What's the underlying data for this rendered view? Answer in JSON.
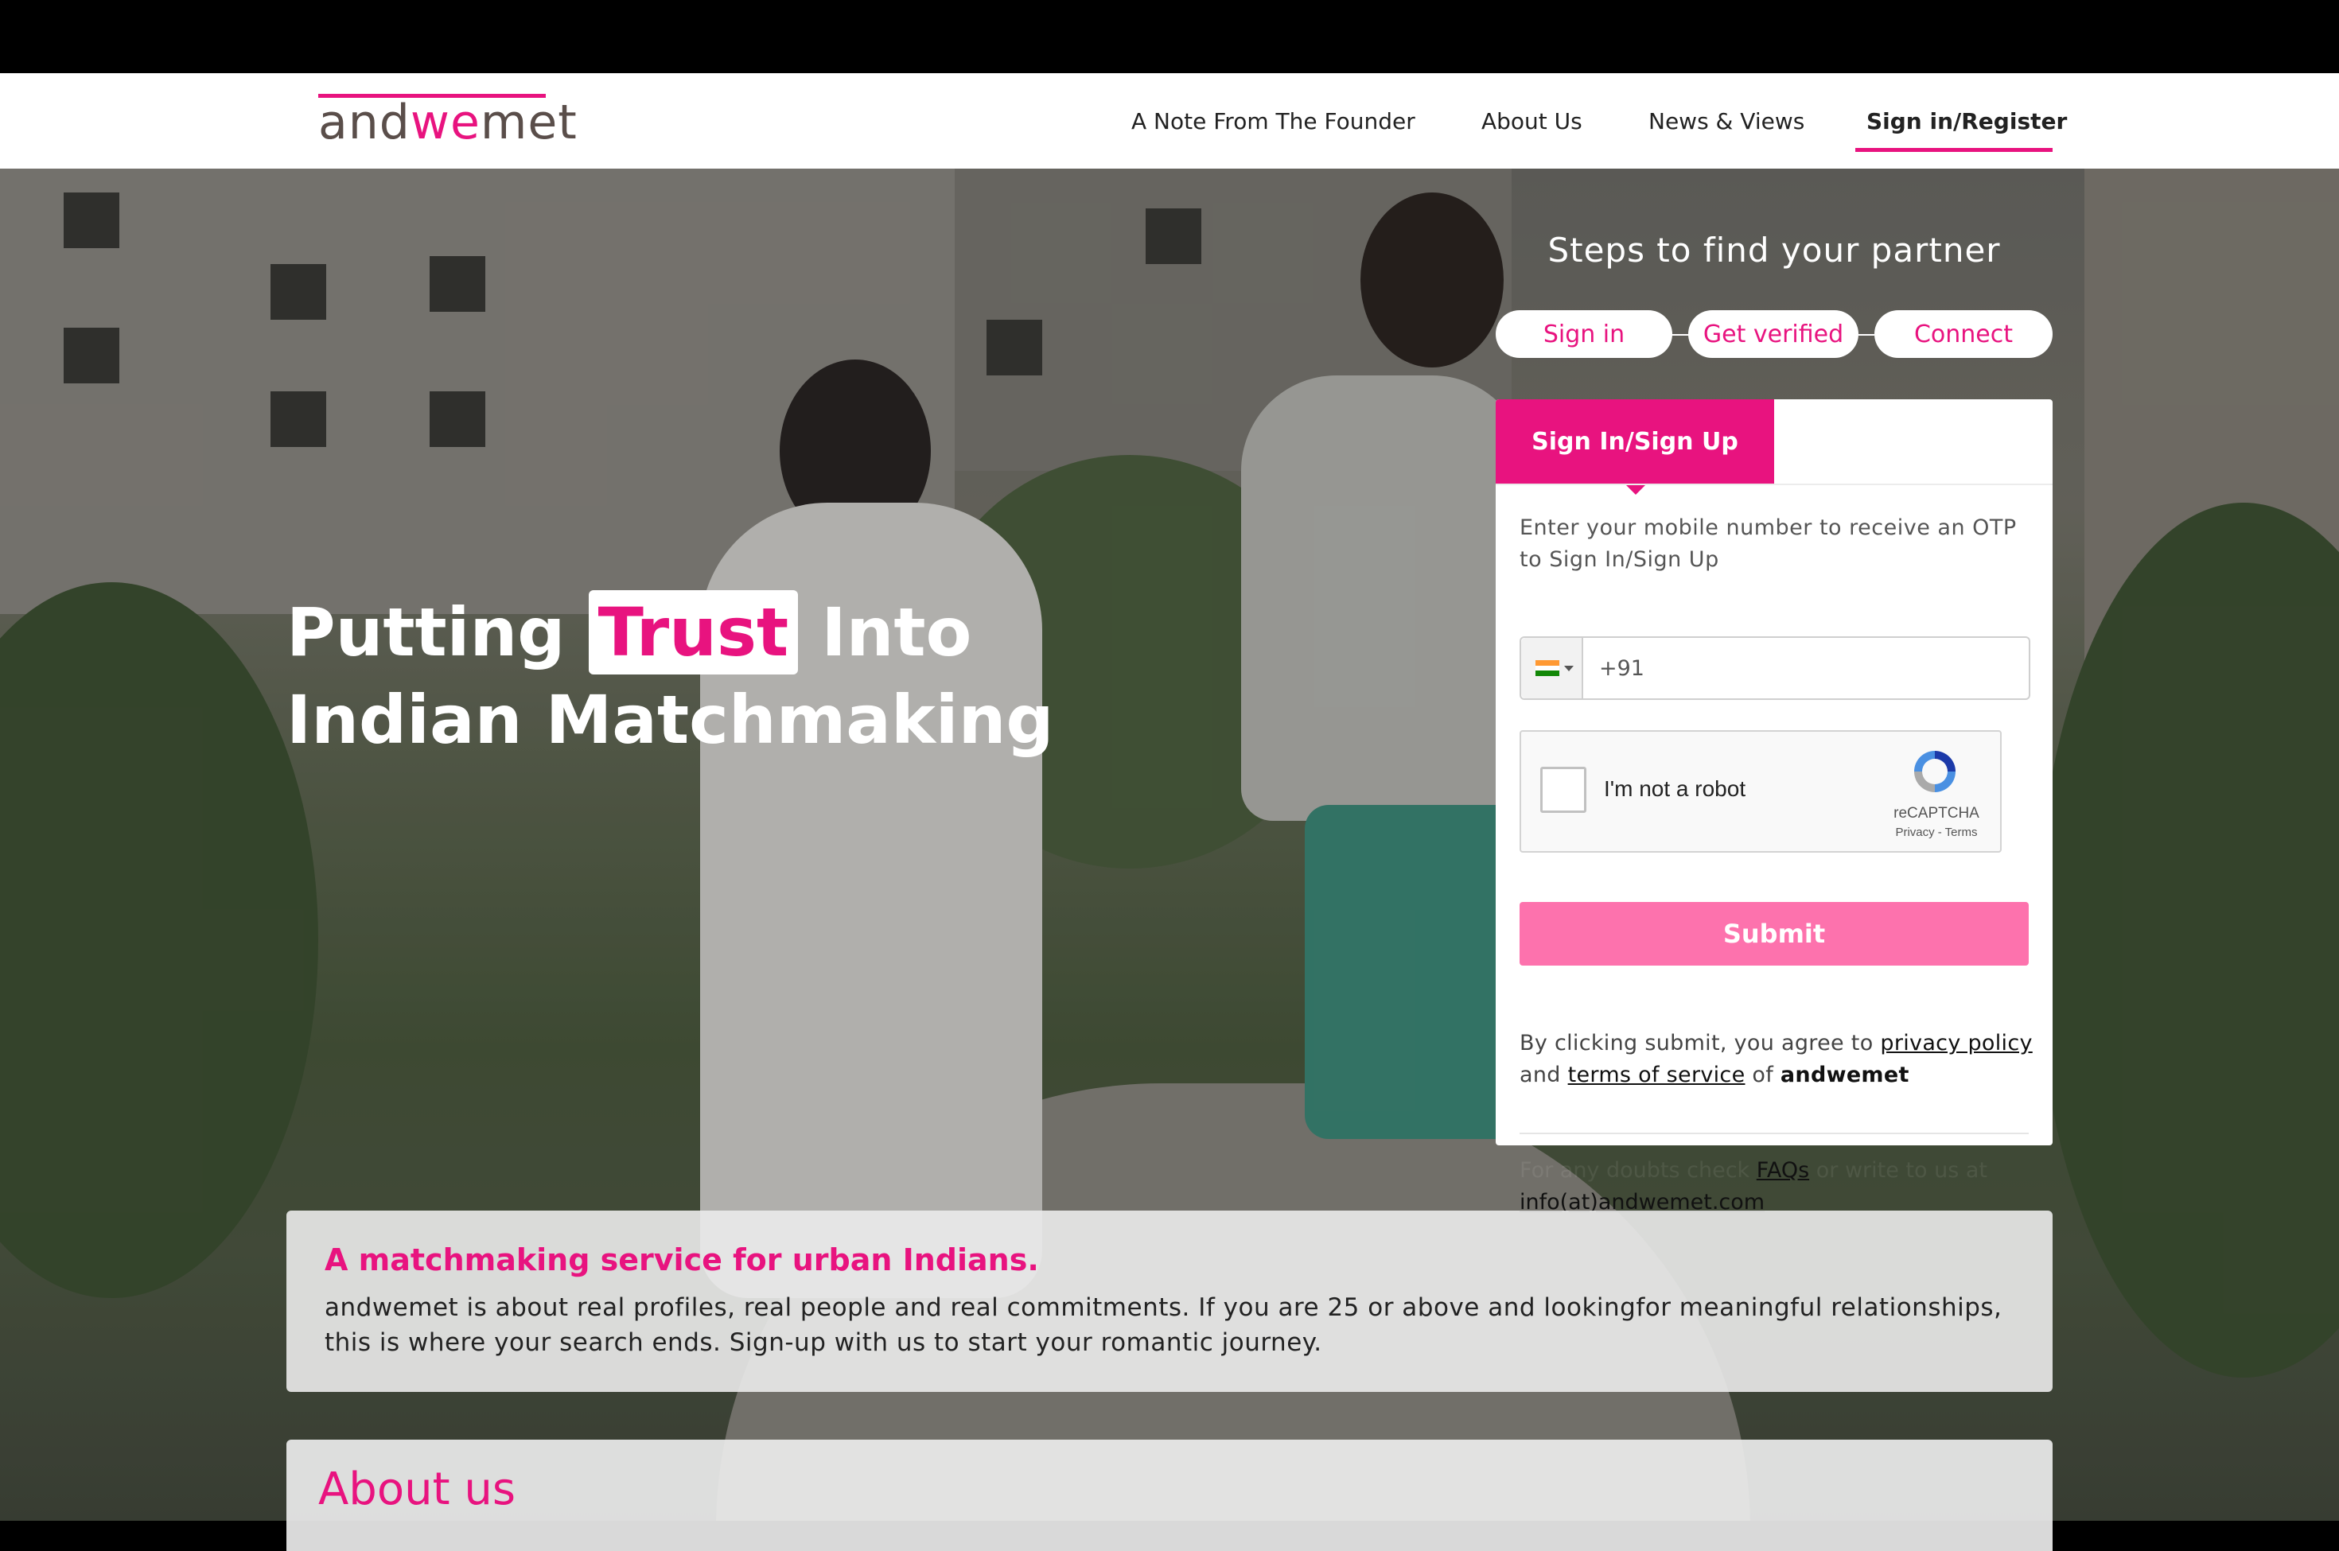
{
  "brand": {
    "logo_prefix": "and",
    "logo_accent": "we",
    "logo_suffix": "met",
    "accent_color": "#e8137f",
    "submit_color": "#fd72ad"
  },
  "nav": {
    "founder": "A Note From The Founder",
    "about": "About Us",
    "news": "News & Views",
    "signin": "Sign in/Register"
  },
  "hero": {
    "headline_before": "Putting",
    "headline_highlight": "Trust",
    "headline_after": "Into",
    "headline_line2": "Indian Matchmaking"
  },
  "steps": {
    "title": "Steps to find your partner",
    "items": [
      "Sign in",
      "Get verified",
      "Connect"
    ]
  },
  "panel": {
    "tab_label": "Sign In/Sign Up",
    "description": "Enter your mobile number to receive an OTP to Sign In/Sign Up",
    "phone_value": "+91",
    "flag_icon": "india-flag-icon",
    "captcha_label": "I'm not a robot",
    "captcha_brand": "reCAPTCHA",
    "captcha_links": "Privacy - Terms",
    "submit_label": "Submit",
    "agree_prefix": "By clicking submit, you agree to",
    "privacy_link": "privacy policy",
    "agree_and": "and",
    "terms_link": "terms of service",
    "agree_of": "of",
    "agree_brand": "andwemet"
  },
  "faq": {
    "prefix": "For any doubts check",
    "faq_link": "FAQs",
    "middle": "or write to us at",
    "email_link": "info(at)andwemet.com"
  },
  "info": {
    "title": "A matchmaking service for urban Indians.",
    "body": "andwemet is about real profiles, real people and real commitments. If you are 25 or above and lookingfor meaningful relationships, this is where your search ends. Sign-up with us to start your romantic journey."
  },
  "about": {
    "title": "About us"
  }
}
